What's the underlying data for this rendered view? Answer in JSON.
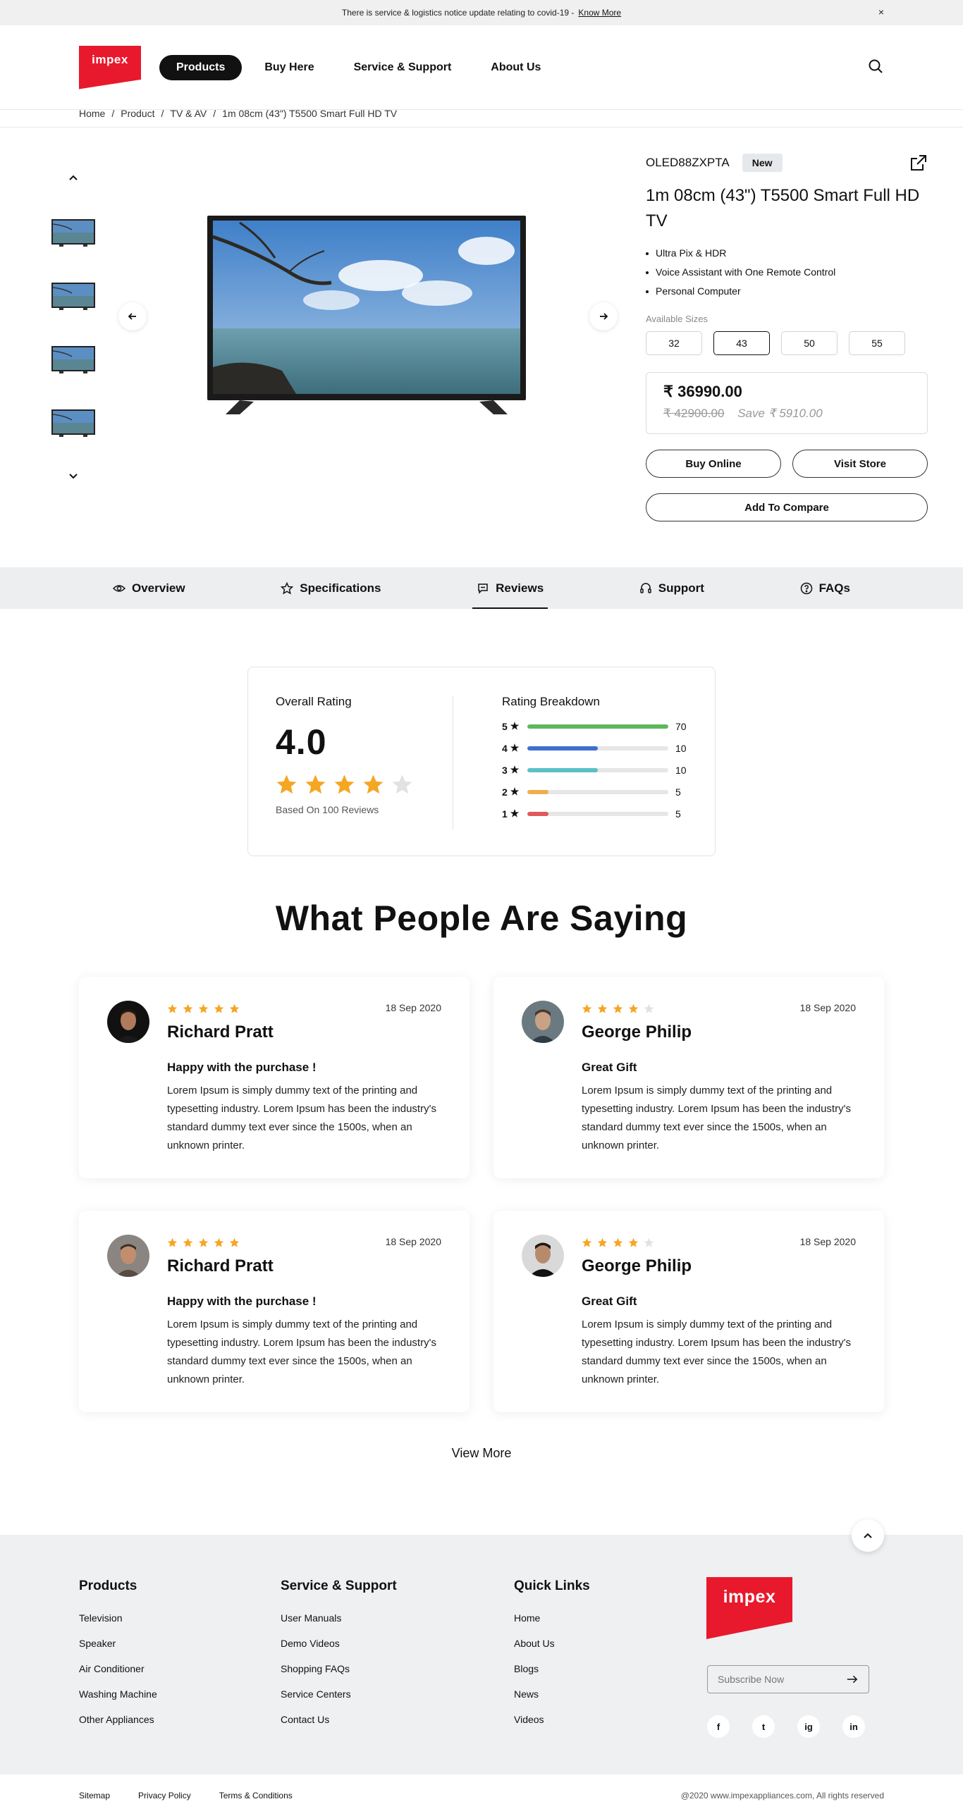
{
  "notice": {
    "text": "There is service & logistics notice update relating to covid-19  -",
    "link": "Know More",
    "close": "×"
  },
  "logo": {
    "text": "impex"
  },
  "nav": [
    "Products",
    "Buy Here",
    "Service & Support",
    "About Us"
  ],
  "breadcrumb": [
    "Home",
    "Product",
    "TV & AV",
    "1m 08cm (43\") T5500 Smart Full HD TV"
  ],
  "product": {
    "model": "OLED88ZXPTA",
    "badge": "New",
    "title": "1m 08cm (43\") T5500 Smart Full HD TV",
    "features": [
      "Ultra Pix & HDR",
      "Voice Assistant with One Remote Control",
      "Personal Computer"
    ],
    "sizes_label": "Available Sizes",
    "sizes": [
      "32",
      "43",
      "50",
      "55"
    ],
    "selected_size": "43",
    "price": "₹ 36990.00",
    "old_price": "₹ 42900.00",
    "save": "Save ₹ 5910.00",
    "buy_online": "Buy Online",
    "visit_store": "Visit Store",
    "compare": "Add To Compare"
  },
  "tabs": [
    "Overview",
    "Specifications",
    "Reviews",
    "Support",
    "FAQs"
  ],
  "active_tab": "Reviews",
  "rating": {
    "label": "Overall Rating",
    "score": "4.0",
    "stars": 4,
    "based_on": "Based On 100 Reviews",
    "breakdown_label": "Rating Breakdown",
    "breakdown": [
      {
        "star": "5",
        "count": "70",
        "fill": 1.0,
        "color": "#5cb85c"
      },
      {
        "star": "4",
        "count": "10",
        "fill": 0.5,
        "color": "#3e6fd0"
      },
      {
        "star": "3",
        "count": "10",
        "fill": 0.5,
        "color": "#5bc0c6"
      },
      {
        "star": "2",
        "count": "5",
        "fill": 0.15,
        "color": "#f0ad4e"
      },
      {
        "star": "1",
        "count": "5",
        "fill": 0.15,
        "color": "#e05a5a"
      }
    ]
  },
  "section_title": "What People Are Saying",
  "reviews": [
    {
      "name": "Richard Pratt",
      "date": "18 Sep 2020",
      "stars": 5,
      "headline": "Happy with the purchase !",
      "text": "Lorem Ipsum is simply dummy text of the printing and typesetting industry. Lorem Ipsum has been the industry's standard dummy text ever since the 1500s, when an unknown printer."
    },
    {
      "name": "George Philip",
      "date": "18 Sep 2020",
      "stars": 4,
      "headline": "Great Gift",
      "text": "Lorem Ipsum is simply dummy text of the printing and typesetting industry. Lorem Ipsum has been the industry's standard dummy text ever since the 1500s, when an unknown printer."
    },
    {
      "name": "Richard Pratt",
      "date": "18 Sep 2020",
      "stars": 5,
      "headline": "Happy with the purchase !",
      "text": "Lorem Ipsum is simply dummy text of the printing and typesetting industry. Lorem Ipsum has been the industry's standard dummy text ever since the 1500s, when an unknown printer."
    },
    {
      "name": "George Philip",
      "date": "18 Sep 2020",
      "stars": 4,
      "headline": "Great Gift",
      "text": "Lorem Ipsum is simply dummy text of the printing and typesetting industry. Lorem Ipsum has been the industry's standard dummy text ever since the 1500s, when an unknown printer."
    }
  ],
  "view_more": "View More",
  "footer": {
    "products": {
      "title": "Products",
      "links": [
        "Television",
        "Speaker",
        "Air Conditioner",
        "Washing Machine",
        "Other Appliances"
      ]
    },
    "service": {
      "title": "Service & Support",
      "links": [
        "User Manuals",
        "Demo Videos",
        "Shopping FAQs",
        "Service Centers",
        "Contact Us"
      ]
    },
    "quick": {
      "title": "Quick Links",
      "links": [
        "Home",
        "About Us",
        "Blogs",
        "News",
        "Videos"
      ]
    },
    "logo": "impex",
    "subscribe_placeholder": "Subscribe Now",
    "socials": [
      "f",
      "t",
      "ig",
      "in"
    ]
  },
  "bottom": {
    "links": [
      "Sitemap",
      "Privacy Policy",
      "Terms & Conditions"
    ],
    "copyright": "@2020 www.impexappliances.com, All rights reserved"
  },
  "colors": {
    "brand": "#e8192c",
    "star": "#f5a623",
    "star_empty": "#e2e2e2"
  }
}
